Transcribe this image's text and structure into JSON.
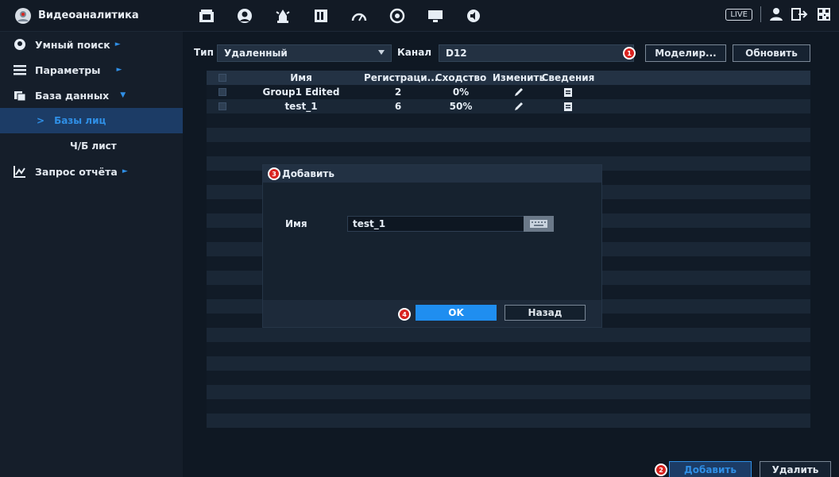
{
  "app": {
    "title": "Видеоаналитика",
    "live": "LIVE"
  },
  "sidebar": {
    "items": [
      {
        "label": "Умный поиск"
      },
      {
        "label": "Параметры"
      },
      {
        "label": "База данных"
      },
      {
        "label": "Базы лиц"
      },
      {
        "label": "Ч/Б лист"
      },
      {
        "label": "Запрос отчёта"
      }
    ]
  },
  "filters": {
    "type_label": "Тип",
    "type_value": "Удаленный",
    "channel_label": "Канал",
    "channel_value": "D12",
    "model_button": "Моделир...",
    "refresh_button": "Обновить"
  },
  "table": {
    "headers": {
      "name": "Имя",
      "reg": "Регистраци...",
      "sim": "Сходство",
      "edit": "Изменить",
      "info": "Сведения"
    },
    "rows": [
      {
        "name": "Group1 Edited",
        "reg": "2",
        "sim": "0%"
      },
      {
        "name": "test_1",
        "reg": "6",
        "sim": "50%"
      }
    ]
  },
  "dialog": {
    "title": "Добавить",
    "name_label": "Имя",
    "name_value": "test_1",
    "ok": "OK",
    "back": "Назад"
  },
  "footer": {
    "add": "Добавить",
    "delete": "Удалить"
  },
  "badges": {
    "b1": "1",
    "b2": "2",
    "b3": "3",
    "b4": "4"
  },
  "colors": {
    "accent": "#1f8ef0",
    "badge": "#d9231f",
    "sidebar_active": "#1c3c66"
  }
}
